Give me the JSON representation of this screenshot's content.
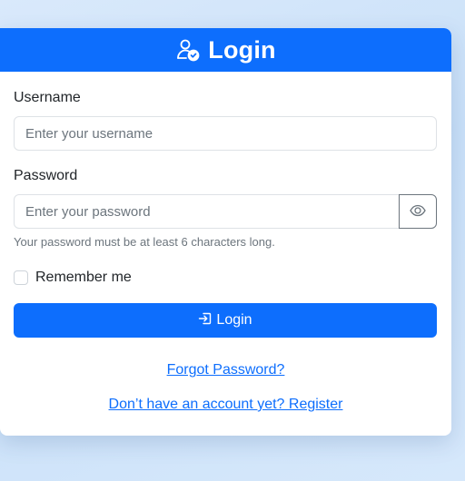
{
  "header": {
    "title": "Login",
    "icon": "user-check-icon"
  },
  "form": {
    "username": {
      "label": "Username",
      "placeholder": "Enter your username",
      "value": ""
    },
    "password": {
      "label": "Password",
      "placeholder": "Enter your password",
      "value": "",
      "toggle_icon": "eye-icon",
      "help": "Your password must be at least 6 characters long."
    },
    "remember": {
      "label": "Remember me",
      "checked": false
    },
    "submit": {
      "label": "Login",
      "icon": "login-icon"
    }
  },
  "links": {
    "forgot": "Forgot Password?",
    "register": "Don’t have an account yet? Register"
  },
  "colors": {
    "primary": "#0d6efd",
    "background": "#d3e6fa",
    "muted_text": "#6c757d"
  }
}
